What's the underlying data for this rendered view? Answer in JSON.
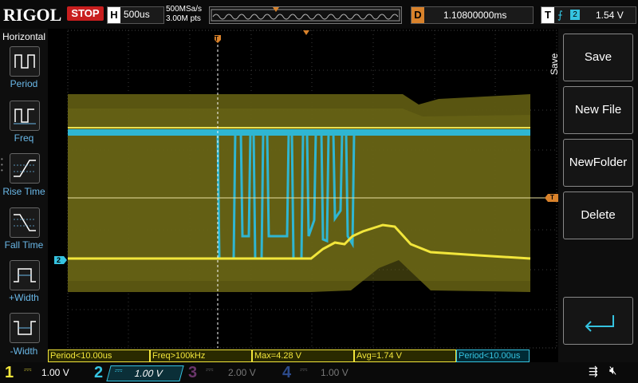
{
  "top": {
    "logo": "RIGOL",
    "run_state": "STOP",
    "horizontal_letter": "H",
    "timebase": "500us",
    "sample_rate": "500MSa/s",
    "memory_depth": "3.00M pts",
    "delay_letter": "D",
    "delay_value": "1.10800000ms",
    "trigger_letter": "T",
    "trigger_source": "2",
    "trigger_level": "1.54 V",
    "trigger_marker": "T"
  },
  "left_menu": {
    "title": "Horizontal",
    "items": [
      {
        "label": "Period"
      },
      {
        "label": "Freq"
      },
      {
        "label": "Rise Time"
      },
      {
        "label": "Fall Time"
      },
      {
        "label": "+Width"
      },
      {
        "label": "-Width"
      }
    ]
  },
  "right_menu": {
    "title": "Save",
    "buttons": [
      {
        "label": "Save"
      },
      {
        "label": "New File"
      },
      {
        "label": "NewFolder"
      },
      {
        "label": "Delete"
      }
    ]
  },
  "measurements": {
    "period1": "Period<10.00us",
    "freq": "Freq>100kHz",
    "max": "Max=4.28 V",
    "avg": "Avg=1.74 V",
    "period2": "Period<10.00us"
  },
  "channels": [
    {
      "num": "1",
      "scale": "1.00 V",
      "color": "#f2e63b"
    },
    {
      "num": "2",
      "scale": "1.00 V",
      "color": "#35c3e0"
    },
    {
      "num": "3",
      "scale": "2.00 V",
      "color": "#c05ac0"
    },
    {
      "num": "4",
      "scale": "1.00 V",
      "color": "#3a62c8"
    }
  ],
  "ch2_marker": "2",
  "colors": {
    "ch1": "#f2e63b",
    "ch2": "#35c3e0",
    "trigger": "#d9822b",
    "stop": "#c81e1e"
  }
}
